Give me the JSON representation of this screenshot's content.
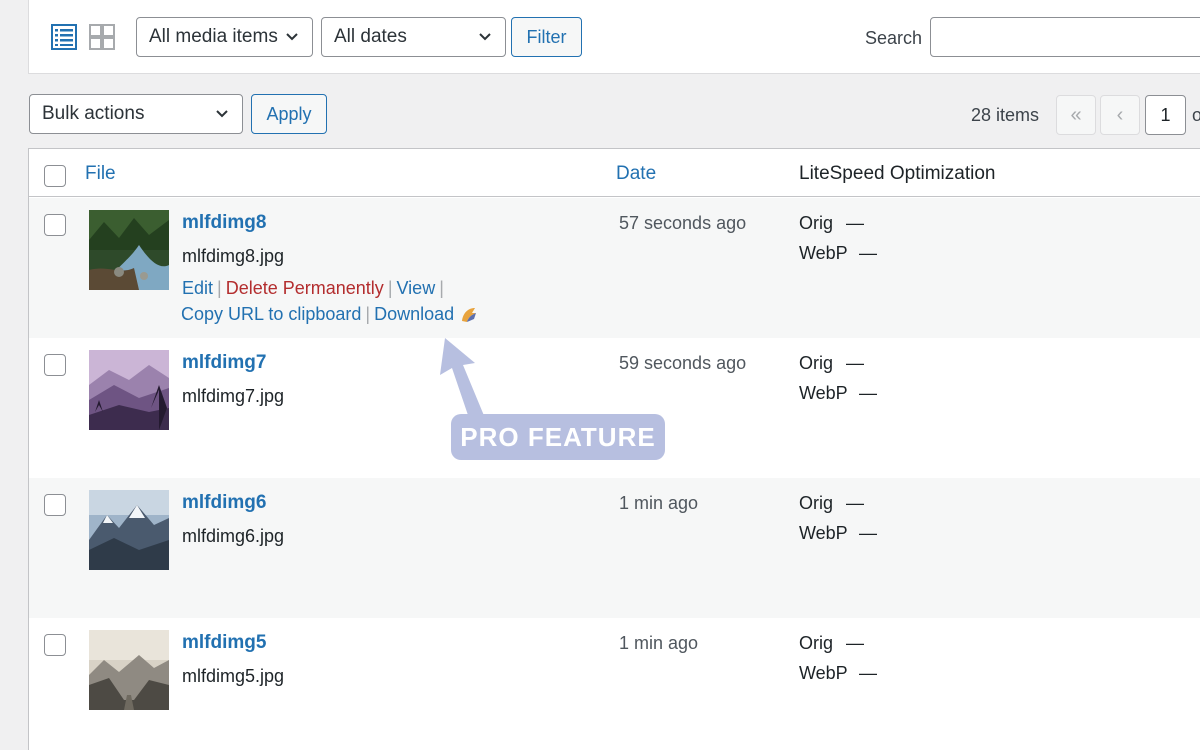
{
  "filters": {
    "media_type": "All media items",
    "dates": "All dates",
    "filter_button": "Filter",
    "search_label": "Search",
    "search_value": ""
  },
  "bulk": {
    "select": "Bulk actions",
    "apply": "Apply"
  },
  "pagination": {
    "items_count": "28 items",
    "first": "«",
    "prev": "‹",
    "current_page": "1",
    "of_label": "o"
  },
  "table": {
    "columns": {
      "file": "File",
      "date": "Date",
      "litespeed": "LiteSpeed Optimization"
    },
    "rows": [
      {
        "title": "mlfdimg8",
        "filename": "mlfdimg8.jpg",
        "date": "57 seconds ago",
        "orig": "Orig",
        "orig_val": "—",
        "webp": "WebP",
        "webp_val": "—"
      },
      {
        "title": "mlfdimg7",
        "filename": "mlfdimg7.jpg",
        "date": "59 seconds ago",
        "orig": "Orig",
        "orig_val": "—",
        "webp": "WebP",
        "webp_val": "—"
      },
      {
        "title": "mlfdimg6",
        "filename": "mlfdimg6.jpg",
        "date": "1 min ago",
        "orig": "Orig",
        "orig_val": "—",
        "webp": "WebP",
        "webp_val": "—"
      },
      {
        "title": "mlfdimg5",
        "filename": "mlfdimg5.jpg",
        "date": "1 min ago",
        "orig": "Orig",
        "orig_val": "—",
        "webp": "WebP",
        "webp_val": "—"
      }
    ],
    "row_actions": {
      "edit": "Edit",
      "delete": "Delete Permanently",
      "view": "View",
      "copy_url": "Copy URL to clipboard",
      "download": "Download"
    }
  },
  "callout": {
    "label": "PRO FEATURE"
  },
  "colors": {
    "link": "#2271b1",
    "delete": "#b32d2e",
    "callout": "#b7bfe0"
  }
}
